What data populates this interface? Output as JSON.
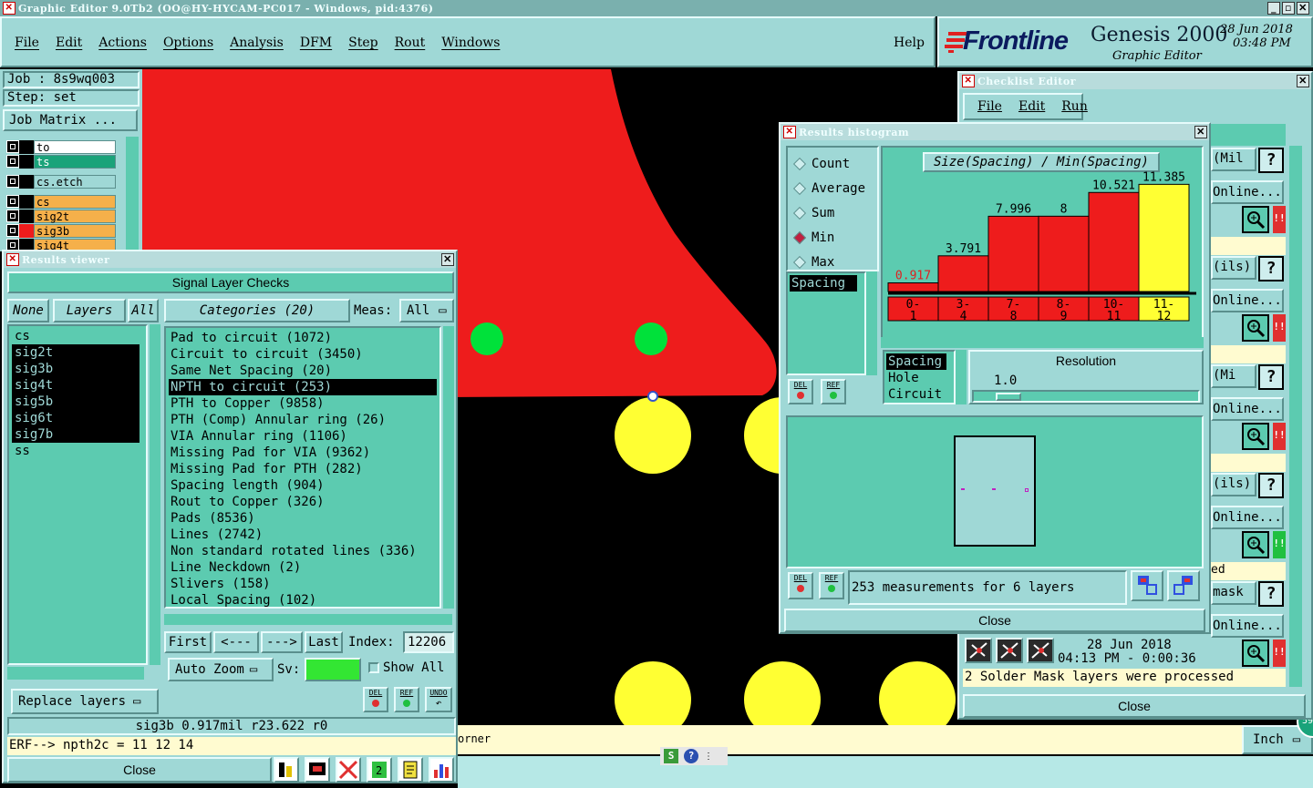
{
  "window": {
    "title": "Graphic Editor 9.0Tb2 (OO@HY-HYCAM-PC017 - Windows, pid:4376)"
  },
  "menubar": {
    "items": [
      "File",
      "Edit",
      "Actions",
      "Options",
      "Analysis",
      "DFM",
      "Step",
      "Rout",
      "Windows"
    ],
    "help": "Help"
  },
  "brand": {
    "logo": "Frontline",
    "product": "Genesis 2000",
    "subtitle": "Graphic Editor",
    "date": "28 Jun 2018",
    "time": "03:48 PM"
  },
  "job": {
    "job_label": "Job : 8s9wq003",
    "step_label": "Step: set",
    "matrix_button": "Job Matrix ..."
  },
  "layer_list": [
    {
      "name": "to",
      "color": "#ffffff"
    },
    {
      "name": "ts",
      "color": "#1aa37a"
    },
    {
      "name": "cs.etch",
      "color": "#9fd8d6"
    },
    {
      "name": "cs",
      "color": "#f5b04a"
    },
    {
      "name": "sig2t",
      "color": "#f5b04a"
    },
    {
      "name": "sig3b",
      "color": "#f5b04a"
    },
    {
      "name": "sig4t",
      "color": "#f5b04a"
    }
  ],
  "results_viewer": {
    "title": "Results viewer",
    "header": "Signal Layer Checks",
    "none_btn": "None",
    "layers_btn": "Layers",
    "all_btn": "All",
    "categories_btn": "Categories (20)",
    "meas_label": "Meas:",
    "meas_value": "All",
    "layers": [
      "cs",
      "sig2t",
      "sig3b",
      "sig4t",
      "sig5b",
      "sig6t",
      "sig7b",
      "ss"
    ],
    "categories": [
      "Pad to circuit (1072)",
      "Circuit to circuit (3450)",
      "Same Net Spacing (20)",
      "NPTH to circuit (253)",
      "PTH to Copper (9858)",
      "PTH (Comp) Annular ring (26)",
      "VIA Annular ring (1106)",
      "Missing Pad for VIA (9362)",
      "Missing Pad for PTH (282)",
      "Spacing length (904)",
      "Rout to Copper (326)",
      "Pads (8536)",
      "Lines (2742)",
      "Non standard rotated lines (336)",
      "Line Neckdown (2)",
      "Slivers (158)",
      "Local Spacing (102)"
    ],
    "first_btn": "First",
    "prev_btn": "<---",
    "next_btn": "--->",
    "last_btn": "Last",
    "index_label": "Index:",
    "index_value": "12206",
    "auto_zoom": "Auto Zoom",
    "sv_label": "Sv:",
    "show_all": "Show All",
    "replace_layers": "Replace layers",
    "del": "DEL",
    "ref": "REF",
    "undo": "UNDO",
    "status": "sig3b 0.917mil  r23.622  r0",
    "erf": "ERF--> npth2c = 11 12 14",
    "close": "Close"
  },
  "histogram": {
    "title": "Results histogram",
    "modes": [
      "Count",
      "Average",
      "Sum",
      "Min",
      "Max"
    ],
    "selected_mode": "Min",
    "measure_list": [
      "Spacing"
    ],
    "chart_title": "Size(Spacing) / Min(Spacing)",
    "types": [
      "Spacing",
      "Hole",
      "Circuit"
    ],
    "resolution_label": "Resolution",
    "resolution_value": "1.0",
    "summary": "253 measurements for 6 layers",
    "close": "Close",
    "del": "DEL",
    "ref": "REF"
  },
  "chart_data": {
    "type": "bar",
    "title": "Size(Spacing) / Min(Spacing)",
    "categories": [
      "0-1",
      "3-4",
      "7-8",
      "8-9",
      "10-11",
      "11-12"
    ],
    "values": [
      0.917,
      3.791,
      7.996,
      8,
      10.521,
      11.385
    ],
    "value_labels": [
      "0.917",
      "3.791",
      "7.996",
      "8",
      "10.521",
      "11.385"
    ],
    "ylim": [
      0,
      12
    ],
    "selected_index": 5,
    "colors": {
      "bar": "#ee1c1c",
      "selected": "#ffff33"
    }
  },
  "checklist": {
    "title": "Checklist Editor",
    "menu": [
      "File",
      "Edit",
      "Run"
    ],
    "row_labels": [
      "(Mil",
      "Online...",
      "(ils)",
      "Online...",
      "(Mi",
      "Online...",
      "(ils)",
      "Online...",
      "ed",
      "mask",
      "Online..."
    ],
    "date": "28 Jun 2018",
    "time": "04:13 PM - 0:00:36",
    "message": "2 Solder Mask layers were processed",
    "close": "Close"
  },
  "bottom": {
    "corner_text": "orner",
    "units": "Inch",
    "badge": "59"
  },
  "colors": {
    "teal": "#9fd8d6",
    "canvas": "#000000",
    "copper": "#ee1c1c",
    "pad_green": "#00e13a",
    "pad_yellow": "#ffff33"
  }
}
